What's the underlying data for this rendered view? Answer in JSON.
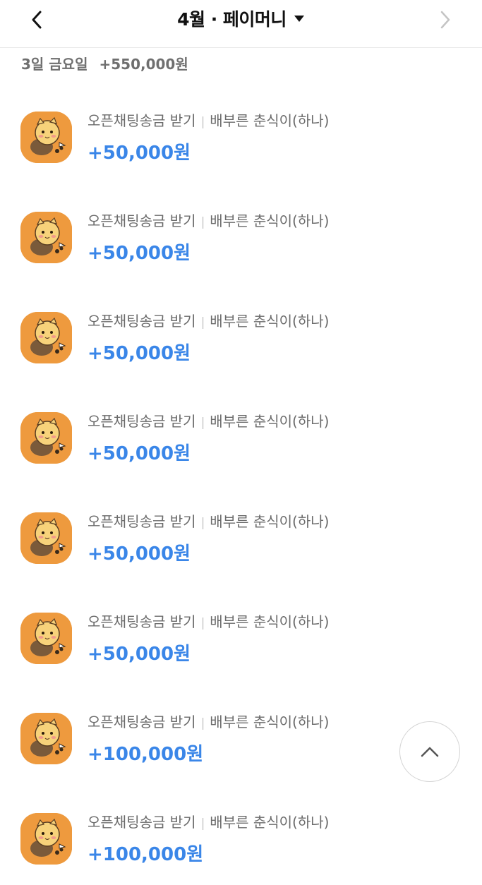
{
  "header": {
    "title": "4월 · 페이머니",
    "back_icon": "chevron-left-icon",
    "next_icon": "chevron-right-icon",
    "dropdown_icon": "caret-down-icon"
  },
  "section": {
    "date": "3일 금요일",
    "total": "+550,000원"
  },
  "transactions": [
    {
      "type": "오픈채팅송금 받기",
      "sender": "배부른 춘식이(하나)",
      "amount": "+50,000원"
    },
    {
      "type": "오픈채팅송금 받기",
      "sender": "배부른 춘식이(하나)",
      "amount": "+50,000원"
    },
    {
      "type": "오픈채팅송금 받기",
      "sender": "배부른 춘식이(하나)",
      "amount": "+50,000원"
    },
    {
      "type": "오픈채팅송금 받기",
      "sender": "배부른 춘식이(하나)",
      "amount": "+50,000원"
    },
    {
      "type": "오픈채팅송금 받기",
      "sender": "배부른 춘식이(하나)",
      "amount": "+50,000원"
    },
    {
      "type": "오픈채팅송금 받기",
      "sender": "배부른 춘식이(하나)",
      "amount": "+50,000원"
    },
    {
      "type": "오픈채팅송금 받기",
      "sender": "배부른 춘식이(하나)",
      "amount": "+100,000원"
    },
    {
      "type": "오픈채팅송금 받기",
      "sender": "배부른 춘식이(하나)",
      "amount": "+100,000원"
    }
  ],
  "scroll_top_icon": "chevron-up-icon",
  "colors": {
    "amount": "#3a86e8",
    "avatar_bg": "#ee9a3e",
    "secondary_text": "#6b6b6b"
  }
}
